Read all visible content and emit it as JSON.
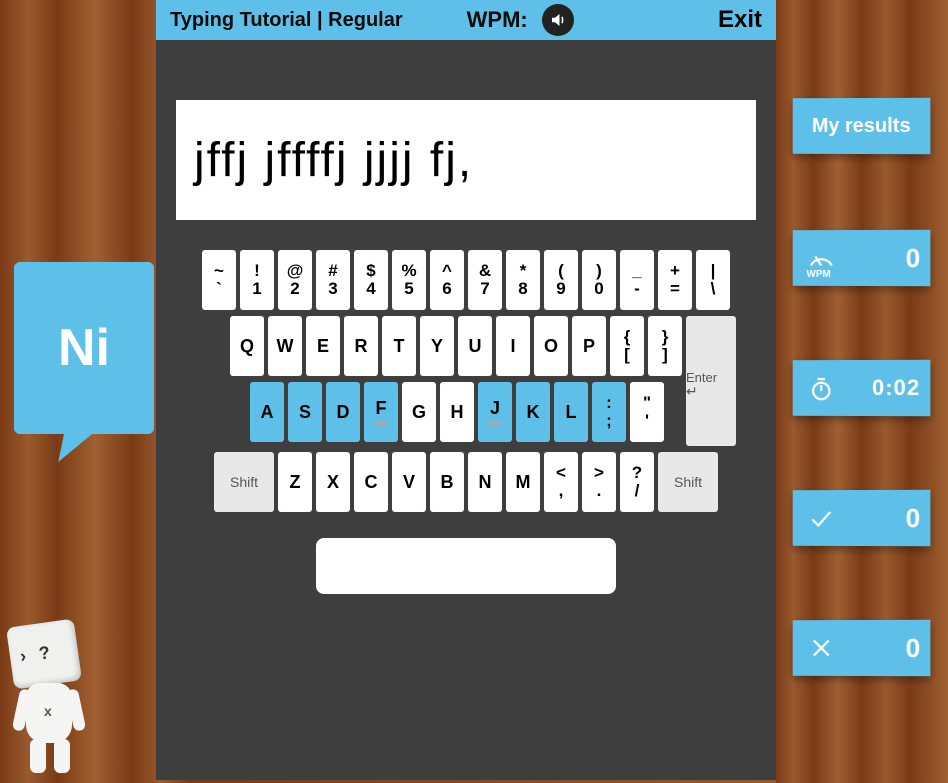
{
  "header": {
    "title": "Typing Tutorial | Regular",
    "wpm_label": "WPM:",
    "exit_label": "Exit"
  },
  "typing_text": "jffj jffffj jjjj fj,",
  "speech": "Ni",
  "keyboard": {
    "row_num": [
      {
        "top": "~",
        "bot": "`"
      },
      {
        "top": "!",
        "bot": "1"
      },
      {
        "top": "@",
        "bot": "2"
      },
      {
        "top": "#",
        "bot": "3"
      },
      {
        "top": "$",
        "bot": "4"
      },
      {
        "top": "%",
        "bot": "5"
      },
      {
        "top": "^",
        "bot": "6"
      },
      {
        "top": "&",
        "bot": "7"
      },
      {
        "top": "*",
        "bot": "8"
      },
      {
        "top": "(",
        "bot": "9"
      },
      {
        "top": ")",
        "bot": "0"
      },
      {
        "top": "_",
        "bot": "-"
      },
      {
        "top": "+",
        "bot": "="
      },
      {
        "top": "|",
        "bot": "\\"
      }
    ],
    "row_top": [
      {
        "l": "Q"
      },
      {
        "l": "W"
      },
      {
        "l": "E"
      },
      {
        "l": "R"
      },
      {
        "l": "T"
      },
      {
        "l": "Y"
      },
      {
        "l": "U"
      },
      {
        "l": "I"
      },
      {
        "l": "O"
      },
      {
        "l": "P"
      },
      {
        "top": "{",
        "bot": "["
      },
      {
        "top": "}",
        "bot": "]"
      }
    ],
    "row_home": [
      {
        "l": "A",
        "h": true
      },
      {
        "l": "S",
        "h": true
      },
      {
        "l": "D",
        "h": true
      },
      {
        "l": "F",
        "h": true,
        "bump": true
      },
      {
        "l": "G"
      },
      {
        "l": "H"
      },
      {
        "l": "J",
        "h": true,
        "bump": true
      },
      {
        "l": "K",
        "h": true
      },
      {
        "l": "L",
        "h": true
      },
      {
        "top": ":",
        "bot": ";",
        "h": true
      },
      {
        "top": "\"",
        "bot": "'"
      }
    ],
    "row_bot": [
      {
        "l": "Z"
      },
      {
        "l": "X"
      },
      {
        "l": "C"
      },
      {
        "l": "V"
      },
      {
        "l": "B"
      },
      {
        "l": "N"
      },
      {
        "l": "M"
      },
      {
        "top": "<",
        "bot": ","
      },
      {
        "top": ">",
        "bot": "."
      },
      {
        "top": "?",
        "bot": "/"
      }
    ],
    "enter_label": "Enter",
    "shift_label": "Shift"
  },
  "sidebar": {
    "results_label": "My results",
    "wpm_caption": "WPM",
    "wpm_value": "0",
    "time_value": "0:02",
    "correct_value": "0",
    "wrong_value": "0"
  }
}
